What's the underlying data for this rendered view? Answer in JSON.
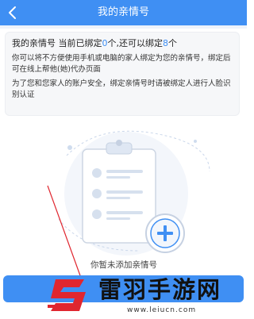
{
  "header": {
    "title": "我的亲情号",
    "back_icon": "chevron-left-icon"
  },
  "info": {
    "status_prefix": "我的亲情号 当前已绑定",
    "bound_count": "0",
    "status_mid": "个,还可以绑定",
    "remaining_count": "8",
    "status_suffix": "个",
    "desc1": "你可以将不方便使用手机或电脑的家人绑定为您的亲情号，绑定后可在线上帮他(她)代办页面",
    "desc2": "为了您和您家人的账户安全，绑定亲情号时请被绑定人进行人脸识别认证",
    "highlight_color": "#3f8ff3"
  },
  "empty_state": {
    "label": "你暂未添加亲情号",
    "illustration_icon": "clipboard-add-icon"
  },
  "watermark": {
    "brand": "雷羽手游网",
    "url": "www.leiucn.com"
  },
  "colors": {
    "primary": "#3f8ff3",
    "accent_red": "#e0262f"
  }
}
